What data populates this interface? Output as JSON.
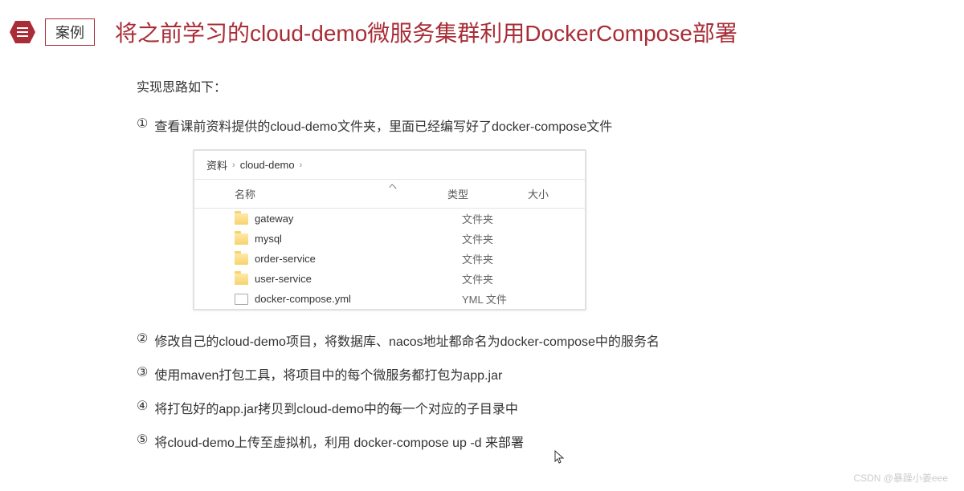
{
  "header": {
    "badge_label": "案例",
    "title": "将之前学习的cloud-demo微服务集群利用DockerCompose部署"
  },
  "intro": "实现思路如下：",
  "steps": {
    "s1": {
      "num": "①",
      "text": "查看课前资料提供的cloud-demo文件夹，里面已经编写好了docker-compose文件"
    },
    "s2": {
      "num": "②",
      "text": "修改自己的cloud-demo项目，将数据库、nacos地址都命名为docker-compose中的服务名"
    },
    "s3": {
      "num": "③",
      "text": "使用maven打包工具，将项目中的每个微服务都打包为app.jar"
    },
    "s4": {
      "num": "④",
      "text": "将打包好的app.jar拷贝到cloud-demo中的每一个对应的子目录中"
    },
    "s5": {
      "num": "⑤",
      "text": "将cloud-demo上传至虚拟机，利用 docker-compose up -d 来部署"
    }
  },
  "browser": {
    "breadcrumb": {
      "p1": "资料",
      "p2": "cloud-demo"
    },
    "headers": {
      "name": "名称",
      "type": "类型",
      "size": "大小"
    },
    "rows": [
      {
        "name": "gateway",
        "type": "文件夹",
        "icon": "folder"
      },
      {
        "name": "mysql",
        "type": "文件夹",
        "icon": "folder"
      },
      {
        "name": "order-service",
        "type": "文件夹",
        "icon": "folder"
      },
      {
        "name": "user-service",
        "type": "文件夹",
        "icon": "folder"
      },
      {
        "name": "docker-compose.yml",
        "type": "YML 文件",
        "icon": "file"
      }
    ]
  },
  "watermark": "CSDN @暴躁小姜eee"
}
